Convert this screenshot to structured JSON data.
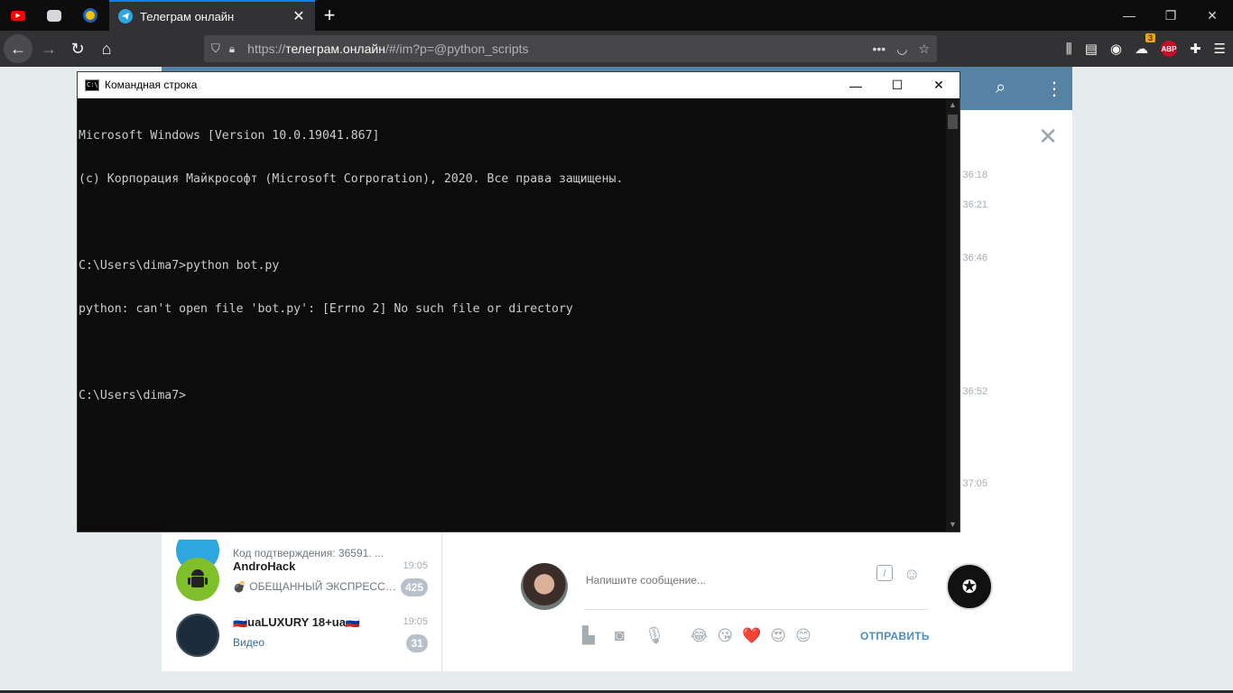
{
  "browser": {
    "active_tab_title": "Телеграм онлайн",
    "url_scheme": "https://",
    "url_host": "телеграм.онлайн",
    "url_path": "/#/im?p=@python_scripts",
    "extension_badge": "3",
    "abp_label": "ABP"
  },
  "telegram": {
    "message_times": [
      "36:18",
      "36:21",
      "36:46",
      "36:52",
      "37:05"
    ],
    "dialogs": [
      {
        "name": "",
        "time": "",
        "preview": "Код подтверждения: 36591. ...",
        "badge": ""
      },
      {
        "name": "AndroHack",
        "time": "19:05",
        "preview": "💣 ОБЕЩАННЫЙ ЭКСПРЕСС Н...",
        "badge": "425"
      },
      {
        "name": "🇷🇺uaLUXURY 18+ua🇷🇺",
        "time": "19:05",
        "preview": "Видео",
        "badge": "31"
      }
    ],
    "compose": {
      "placeholder": "Напишите сообщение...",
      "send_label": "ОТПРАВИТЬ",
      "emojis": [
        "😂",
        "😘",
        "❤️",
        "😍",
        "😊"
      ]
    }
  },
  "cmd": {
    "title": "Командная строка",
    "lines": [
      "Microsoft Windows [Version 10.0.19041.867]",
      "(c) Корпорация Майкрософт (Microsoft Corporation), 2020. Все права защищены.",
      "",
      "C:\\Users\\dima7>python bot.py",
      "python: can't open file 'bot.py': [Errno 2] No such file or directory",
      "",
      "C:\\Users\\dima7>"
    ]
  }
}
